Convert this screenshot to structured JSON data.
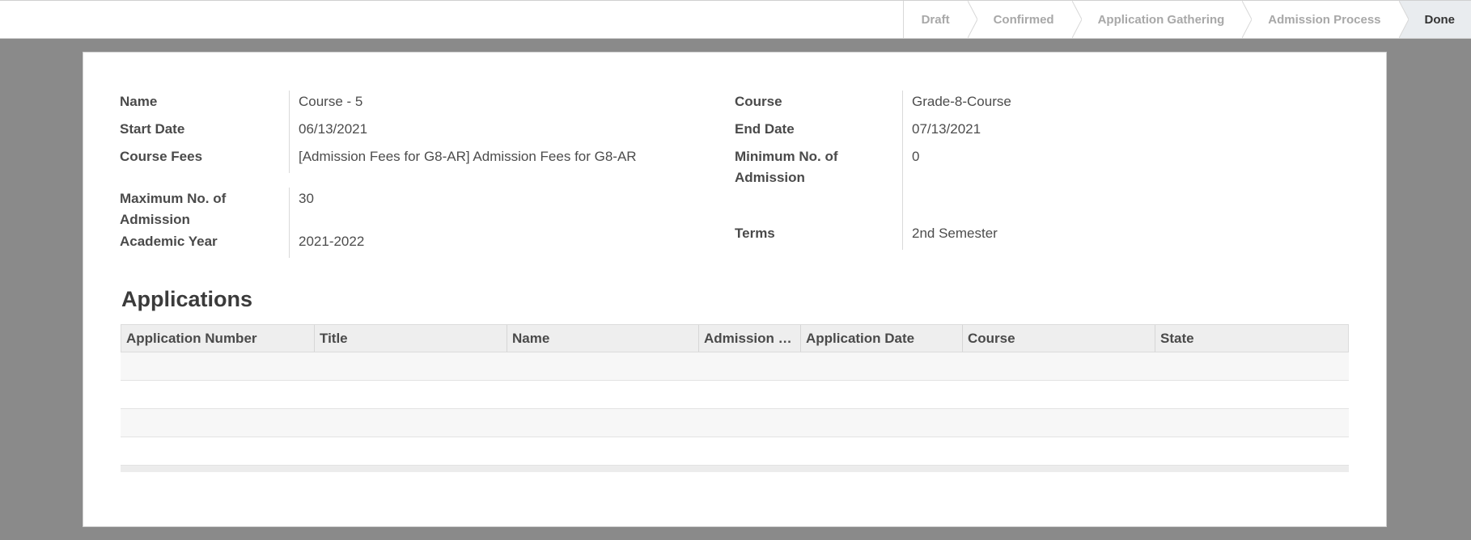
{
  "statusbar": {
    "stages": [
      "Draft",
      "Confirmed",
      "Application Gathering",
      "Admission Process",
      "Done"
    ],
    "active": "Done"
  },
  "form": {
    "left": [
      {
        "label": "Name",
        "value": "Course - 5"
      },
      {
        "label": "Start Date",
        "value": "06/13/2021"
      },
      {
        "label": "Course Fees",
        "value": "[Admission Fees for G8-AR] Admission Fees for G8-AR"
      },
      {
        "label": "Maximum No. of Admission",
        "value": "30"
      },
      {
        "label": "Academic Year",
        "value": "2021-2022"
      }
    ],
    "right": [
      {
        "label": "Course",
        "value": "Grade-8-Course"
      },
      {
        "label": "End Date",
        "value": "07/13/2021"
      },
      {
        "label": "Minimum No. of Admission",
        "value": "0"
      },
      {
        "label": "Terms",
        "value": "2nd Semester"
      }
    ]
  },
  "applications": {
    "title": "Applications",
    "columns": [
      "Application Number",
      "Title",
      "Name",
      "Admission …",
      "Application Date",
      "Course",
      "State"
    ]
  }
}
